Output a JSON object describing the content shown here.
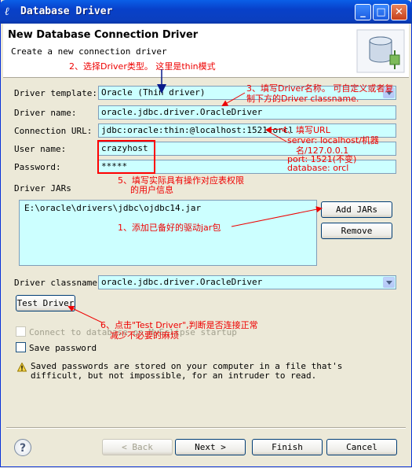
{
  "window": {
    "title": "Database Driver",
    "icons": [
      "eclipse-icon",
      "minimize-icon",
      "maximize-icon",
      "close-icon"
    ]
  },
  "header": {
    "title": "New Database Connection Driver",
    "subtitle": "Create a new connection driver"
  },
  "form": {
    "template_label": "Driver template:",
    "template_value": "Oracle (Thin driver)",
    "name_label": "Driver name:",
    "name_value": "oracle.jdbc.driver.OracleDriver",
    "url_label": "Connection URL:",
    "url_value": "jdbc:oracle:thin:@localhost:1521:orcl",
    "user_label": "User name:",
    "user_value": "crazyhost",
    "password_label": "Password:",
    "password_value": "*****",
    "jars_label": "Driver JARs",
    "jars": [
      "E:\\oracle\\drivers\\jdbc\\ojdbc14.jar"
    ],
    "add_jars": "Add JARs",
    "remove": "Remove",
    "classname_label": "Driver classname:",
    "classname_value": "oracle.jdbc.driver.OracleDriver",
    "test_driver": "Test Driver",
    "connect_startup": "Connect to database on MyEclipse startup",
    "save_password": "Save password",
    "warning": "Saved passwords are stored on your computer in a file that's difficult, but not impossible, for an intruder to read."
  },
  "buttons": {
    "back": "< Back",
    "next": "Next >",
    "finish": "Finish",
    "cancel": "Cancel"
  },
  "annotations": {
    "a2": "2、选择Driver类型。 这里是thin模式",
    "a3_line1": "3、填写Driver名称。 可自定义或者复",
    "a3_line2": "制下方的Driver classname.",
    "a4_line1": "4、填写URL",
    "a4_line2": "server: localhost/机器",
    "a4_line3": "名/127.0.0.1",
    "a4_line4": "port:  1521(不变)",
    "a4_line5": "database: orcl",
    "a5_line1": "5、填写实际具有操作对应表权限",
    "a5_line2": "的用户信息",
    "a1": "1、添加已备好的驱动jar包",
    "a6_line1": "6、点击\"Test Driver\",判断是否连接正常",
    "a6_line2": "减少不必要的麻烦"
  }
}
